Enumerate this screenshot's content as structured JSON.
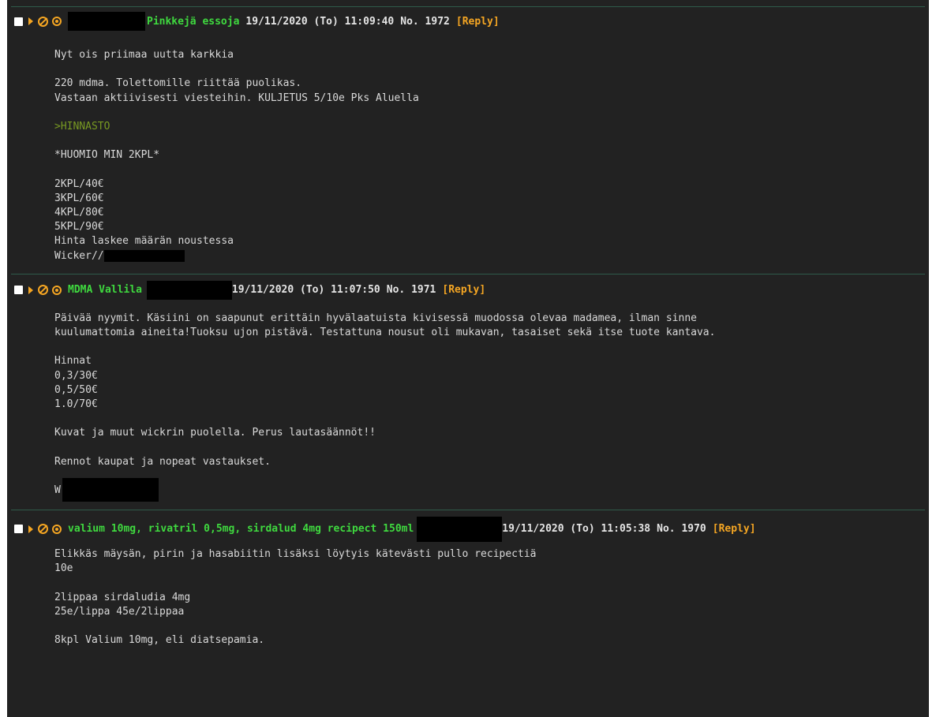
{
  "posts": [
    {
      "subject": "Pinkkejä essoja",
      "date": "19/11/2020 (To) 11:09:40",
      "number": "No. 1972",
      "reply": "[Reply]",
      "lines": [
        "Nyt ois priimaa uutta karkkia",
        "",
        "220 mdma. Tolettomille riittää puolikas.",
        "Vastaan aktiivisesti viesteihin. KULJETUS 5/10e Pks Aluella",
        "",
        ">HINNASTO",
        "",
        "*HUOMIO MIN 2KPL*",
        "",
        "2KPL/40€",
        "3KPL/60€",
        "4KPL/80€",
        "5KPL/90€",
        "Hinta laskee määrän noustessa",
        "Wicker//"
      ]
    },
    {
      "subject": "MDMA Vallila",
      "date": "19/11/2020 (To) 11:07:50",
      "number": "No. 1971",
      "reply": "[Reply]",
      "lines": [
        "Päivää nyymit. Käsiini on saapunut erittäin hyvälaatuista kivisessä muodossa olevaa madamea, ilman sinne",
        "kuulumattomia aineita!Tuoksu ujon pistävä. Testattuna nousut oli mukavan, tasaiset sekä itse tuote kantava.",
        "",
        "Hinnat",
        "0,3/30€",
        "0,5/50€",
        "1.0/70€",
        "",
        "Kuvat ja muut wickrin puolella. Perus lautasäännöt!!",
        "",
        "Rennot kaupat ja nopeat vastaukset.",
        "",
        "W"
      ]
    },
    {
      "subject": "valium 10mg, rivatril 0,5mg, sirdalud 4mg recipect 150ml",
      "date": "19/11/2020 (To) 11:05:38",
      "number": "No. 1970",
      "reply": "[Reply]",
      "lines": [
        "Elikkäs mäysän, pirin ja hasabiitin lisäksi löytyis kätevästi pullo recipectiä",
        "10e",
        "",
        "2lippaa sirdaludia 4mg",
        "25e/lippa 45e/2lippaa",
        "",
        "8kpl Valium 10mg, eli diatsepamia."
      ]
    }
  ]
}
